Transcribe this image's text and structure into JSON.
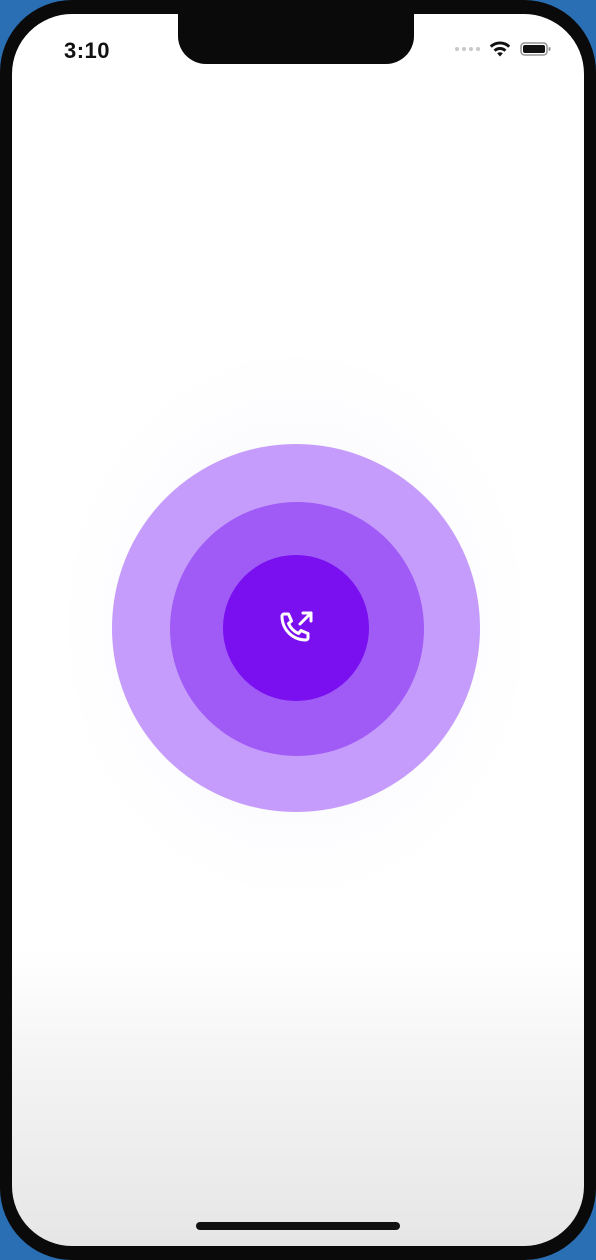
{
  "status_bar": {
    "time": "3:10",
    "wifi_icon": "wifi-icon",
    "battery_icon": "battery-icon"
  },
  "call_button": {
    "icon": "outgoing-call-icon",
    "colors": {
      "outer_ring": "#c59cfb",
      "middle_ring": "#a05af5",
      "button": "#7a0ff0",
      "icon": "#ffffff"
    }
  }
}
